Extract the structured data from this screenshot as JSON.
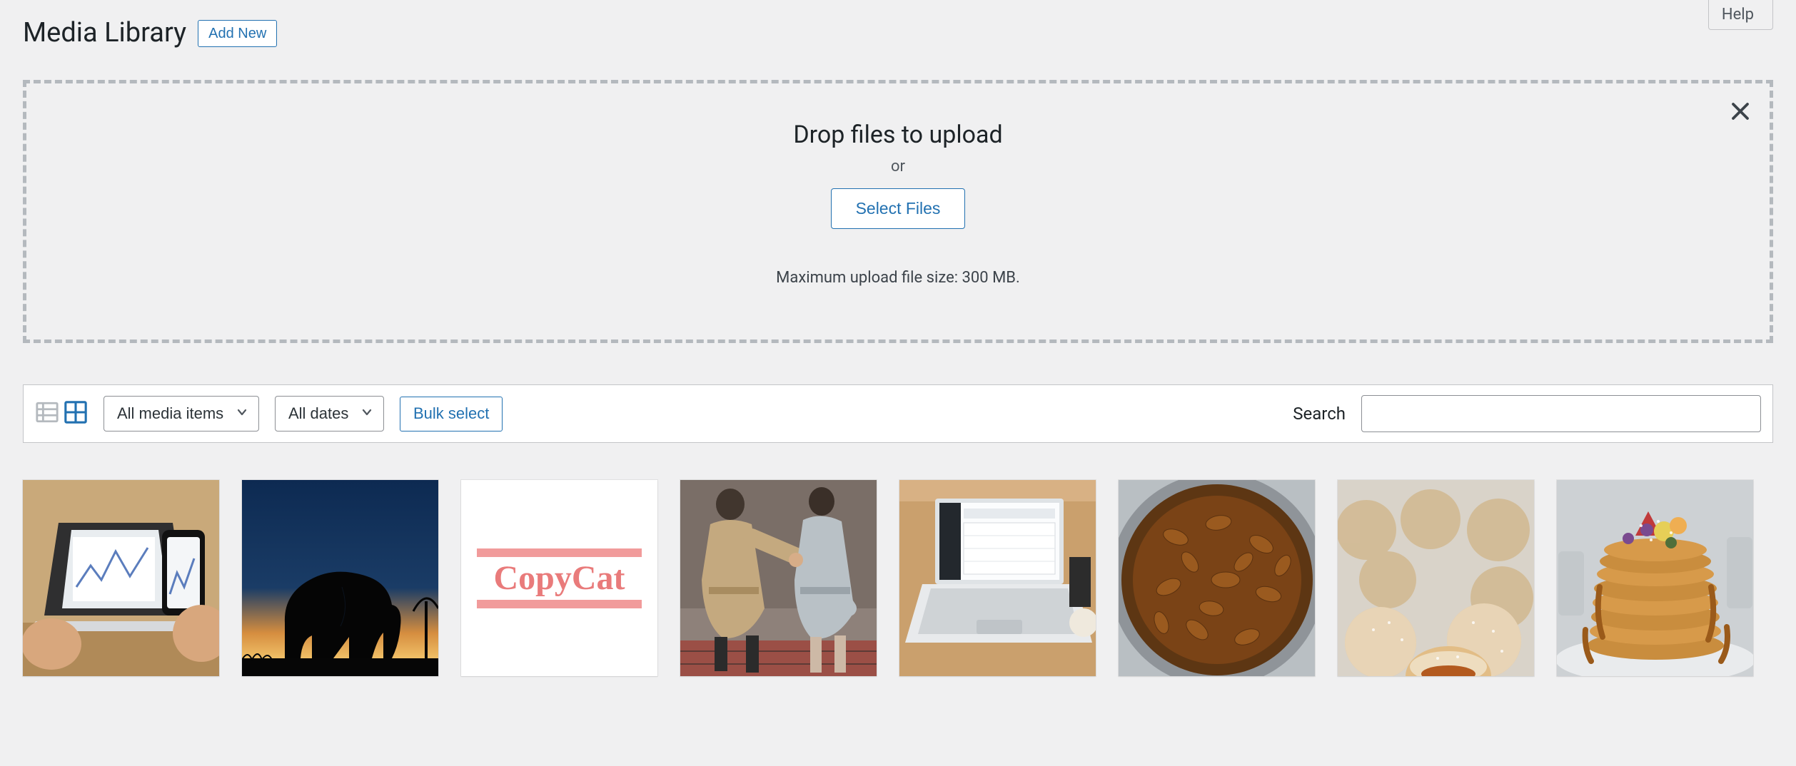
{
  "header": {
    "help_label": "Help",
    "page_title": "Media Library",
    "add_new_label": "Add New"
  },
  "dropzone": {
    "title": "Drop files to upload",
    "or_label": "or",
    "select_files_label": "Select Files",
    "max_size_label": "Maximum upload file size: 300 MB."
  },
  "toolbar": {
    "media_filter_label": "All media items",
    "date_filter_label": "All dates",
    "bulk_select_label": "Bulk select",
    "search_label": "Search"
  },
  "thumbnail_text": {
    "copycat": "CopyCat"
  }
}
